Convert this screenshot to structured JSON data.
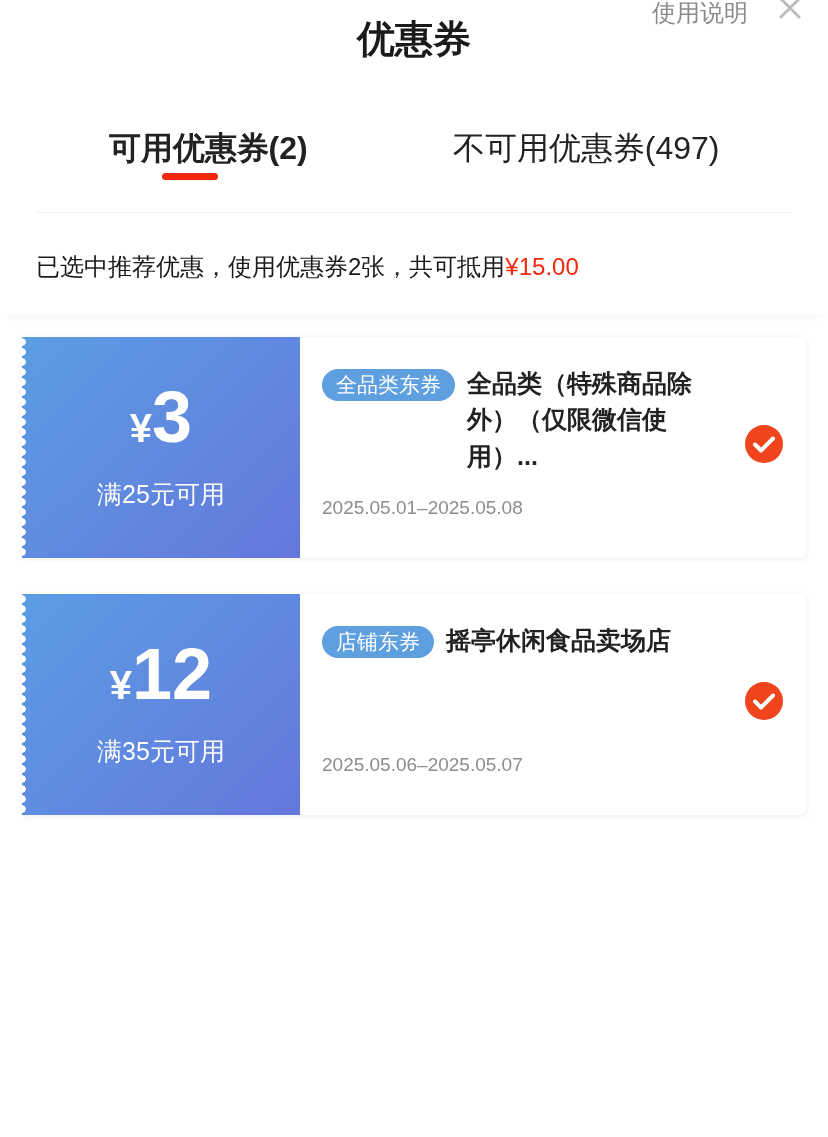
{
  "header": {
    "title": "优惠券",
    "help_link": "使用说明"
  },
  "tabs": [
    {
      "label": "可用优惠券(2)",
      "selected": true
    },
    {
      "label": "不可用优惠券(497)",
      "selected": false
    }
  ],
  "summary": {
    "text": "已选中推荐优惠，使用优惠券2张，共可抵用",
    "amount": "¥15.00"
  },
  "coupons": [
    {
      "currency": "¥",
      "value": "3",
      "condition": "满25元可用",
      "tag": "全品类东券",
      "title": "全品类（特殊商品除外）（仅限微信使用）...",
      "dates": "2025.05.01–2025.05.08",
      "selected": true
    },
    {
      "currency": "¥",
      "value": "12",
      "condition": "满35元可用",
      "tag": "店铺东券",
      "title": "摇亭休闲食品卖场店",
      "dates": "2025.05.06–2025.05.07",
      "selected": true
    }
  ]
}
